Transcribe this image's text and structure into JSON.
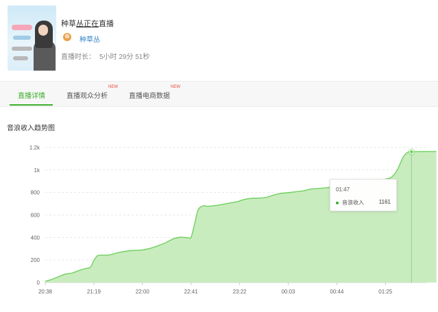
{
  "room": {
    "title_prefix": "种草",
    "title_highlight": "丛正在",
    "title_suffix": "直播",
    "streamer_name": "种草丛",
    "duration_label": "直播时长：",
    "duration_value": "5小时 29分 51秒"
  },
  "tabs": [
    {
      "label": "直播详情",
      "badge": "",
      "active": true
    },
    {
      "label": "直播观众分析",
      "badge": "NEW",
      "active": false
    },
    {
      "label": "直播电商数据",
      "badge": "NEW",
      "active": false
    }
  ],
  "chart_title": "音浪收入趋势图",
  "tooltip": {
    "time": "01:47",
    "series_name": "音浪收入",
    "value": "1161"
  },
  "colors": {
    "accent": "#3cae2c",
    "area_fill": "#c9ecbf",
    "line": "#6fd05d",
    "new_badge": "#e84a3b",
    "link": "#3a86c8"
  },
  "chart_data": {
    "type": "area",
    "title": "",
    "xlabel": "",
    "ylabel": "",
    "ylim": [
      0,
      1200
    ],
    "y_ticks": [
      0,
      200,
      400,
      600,
      800,
      1000,
      1200
    ],
    "y_tick_labels": [
      "0",
      "200",
      "400",
      "600",
      "800",
      "1k",
      "1.2k"
    ],
    "x_tick_labels": [
      "20:38",
      "21:19",
      "22:00",
      "22:41",
      "23:22",
      "00:03",
      "00:44",
      "01:25"
    ],
    "grid": true,
    "series": [
      {
        "name": "音浪收入",
        "points": [
          [
            "20:38",
            10
          ],
          [
            "20:44",
            30
          ],
          [
            "20:50",
            55
          ],
          [
            "20:55",
            75
          ],
          [
            "21:01",
            85
          ],
          [
            "21:06",
            105
          ],
          [
            "21:12",
            125
          ],
          [
            "21:16",
            135
          ],
          [
            "21:19",
            195
          ],
          [
            "21:22",
            238
          ],
          [
            "21:26",
            243
          ],
          [
            "21:32",
            245
          ],
          [
            "21:38",
            262
          ],
          [
            "21:44",
            275
          ],
          [
            "21:50",
            283
          ],
          [
            "21:56",
            287
          ],
          [
            "22:00",
            290
          ],
          [
            "22:07",
            305
          ],
          [
            "22:14",
            330
          ],
          [
            "22:20",
            356
          ],
          [
            "22:26",
            388
          ],
          [
            "22:32",
            402
          ],
          [
            "22:38",
            398
          ],
          [
            "22:41",
            402
          ],
          [
            "22:44",
            520
          ],
          [
            "22:47",
            645
          ],
          [
            "22:51",
            680
          ],
          [
            "22:55",
            678
          ],
          [
            "23:01",
            683
          ],
          [
            "23:07",
            693
          ],
          [
            "23:14",
            707
          ],
          [
            "23:20",
            718
          ],
          [
            "23:26",
            738
          ],
          [
            "23:32",
            748
          ],
          [
            "23:38",
            750
          ],
          [
            "23:44",
            755
          ],
          [
            "23:50",
            775
          ],
          [
            "23:56",
            790
          ],
          [
            "00:03",
            798
          ],
          [
            "00:09",
            806
          ],
          [
            "00:16",
            815
          ],
          [
            "00:22",
            830
          ],
          [
            "00:28",
            835
          ],
          [
            "00:34",
            840
          ],
          [
            "00:40",
            850
          ],
          [
            "00:46",
            862
          ],
          [
            "00:52",
            865
          ],
          [
            "00:58",
            880
          ],
          [
            "01:05",
            885
          ],
          [
            "01:12",
            895
          ],
          [
            "01:18",
            900
          ],
          [
            "01:22",
            910
          ],
          [
            "01:25",
            918
          ],
          [
            "01:30",
            935
          ],
          [
            "01:35",
            1000
          ],
          [
            "01:40",
            1115
          ],
          [
            "01:44",
            1158
          ],
          [
            "01:47",
            1161
          ],
          [
            "01:53",
            1163
          ],
          [
            "02:08",
            1164
          ]
        ]
      }
    ],
    "highlight_point": [
      "01:47",
      1161
    ]
  }
}
